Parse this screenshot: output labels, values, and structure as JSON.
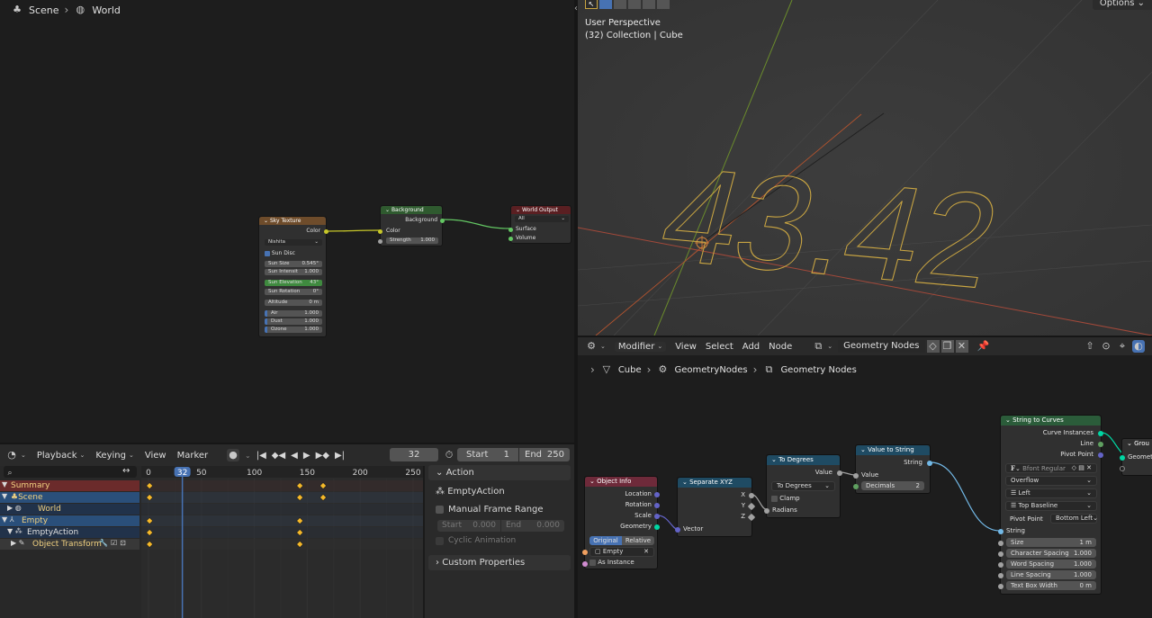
{
  "shader_editor": {
    "breadcrumb": [
      "Scene",
      "World"
    ],
    "sky_texture": {
      "title": "Sky Texture",
      "output": "Color",
      "type": "Nishita",
      "sun_disc": "Sun Disc",
      "sun_size": {
        "label": "Sun Size",
        "value": "0.545°"
      },
      "sun_intensity": {
        "label": "Sun Intensit",
        "value": "1.000"
      },
      "sun_elevation": {
        "label": "Sun Elevation",
        "value": "43°"
      },
      "sun_rotation": {
        "label": "Sun Rotation",
        "value": "0°"
      },
      "altitude": {
        "label": "Altitude",
        "value": "0 m"
      },
      "air": {
        "label": "Air",
        "value": "1.000"
      },
      "dust": {
        "label": "Dust",
        "value": "1.000"
      },
      "ozone": {
        "label": "Ozone",
        "value": "1.000"
      }
    },
    "background": {
      "title": "Background",
      "output": "Background",
      "color": "Color",
      "strength": {
        "label": "Strength",
        "value": "1.000"
      }
    },
    "world_output": {
      "title": "World Output",
      "target": "All",
      "surface": "Surface",
      "volume": "Volume"
    }
  },
  "viewport": {
    "options": "Options",
    "perspective": "User Perspective",
    "collection": "(32) Collection | Cube",
    "text_object": "43.42"
  },
  "geo_editor": {
    "menu": {
      "modifier": "Modifier",
      "view": "View",
      "select": "Select",
      "add": "Add",
      "node": "Node",
      "tree_name": "Geometry Nodes"
    },
    "breadcrumb": [
      "Cube",
      "GeometryNodes",
      "Geometry Nodes"
    ],
    "object_info": {
      "title": "Object Info",
      "outputs": [
        "Location",
        "Rotation",
        "Scale",
        "Geometry"
      ],
      "mode_original": "Original",
      "mode_relative": "Relative",
      "object": "Empty",
      "as_instance": "As Instance"
    },
    "separate_xyz": {
      "title": "Separate XYZ",
      "x": "X",
      "y": "Y",
      "z": "Z",
      "vector": "Vector"
    },
    "to_degrees": {
      "title": "To Degrees",
      "value": "Value",
      "op": "To Degrees",
      "clamp": "Clamp",
      "radians": "Radians"
    },
    "value_to_string": {
      "title": "Value to String",
      "string": "String",
      "value": "Value",
      "decimals": {
        "label": "Decimals",
        "value": "2"
      }
    },
    "string_to_curves": {
      "title": "String to Curves",
      "curve_instances": "Curve Instances",
      "line": "Line",
      "pivot_point_out": "Pivot Point",
      "font": "Bfont Regular",
      "overflow": "Overflow",
      "align_x": "Left",
      "align_y": "Top Baseline",
      "pivot_point": {
        "label": "Pivot Point",
        "value": "Bottom Left"
      },
      "string": "String",
      "size": {
        "label": "Size",
        "value": "1 m"
      },
      "char_spacing": {
        "label": "Character Spacing",
        "value": "1.000"
      },
      "word_spacing": {
        "label": "Word Spacing",
        "value": "1.000"
      },
      "line_spacing": {
        "label": "Line Spacing",
        "value": "1.000"
      },
      "text_box_width": {
        "label": "Text Box Width",
        "value": "0 m"
      }
    },
    "group_output": {
      "title": "Grou",
      "geometry": "Geomet"
    }
  },
  "timeline": {
    "menu": {
      "playback": "Playback",
      "keying": "Keying",
      "view": "View",
      "marker": "Marker"
    },
    "current_frame": "32",
    "start_label": "Start",
    "start": "1",
    "end_label": "End",
    "end": "250",
    "ruler": [
      "0",
      "32",
      "50",
      "100",
      "150",
      "200",
      "250"
    ],
    "channels": [
      {
        "label": "Summary",
        "kind": "summary"
      },
      {
        "label": "Scene",
        "kind": "scene"
      },
      {
        "label": "World",
        "kind": "world"
      },
      {
        "label": "Empty",
        "kind": "object"
      },
      {
        "label": "EmptyAction",
        "kind": "action"
      },
      {
        "label": "Object Transform",
        "kind": "group"
      }
    ],
    "keyframes": [
      {
        "channel": 0,
        "frames": [
          1,
          143,
          165
        ]
      },
      {
        "channel": 1,
        "frames": [
          1,
          143,
          165
        ]
      },
      {
        "channel": 3,
        "frames": [
          1,
          143
        ]
      },
      {
        "channel": 4,
        "frames": [
          1,
          143
        ]
      },
      {
        "channel": 5,
        "frames": [
          1,
          143
        ]
      }
    ]
  },
  "action_panel": {
    "title": "Action",
    "action_name": "EmptyAction",
    "manual_frame_range": "Manual Frame Range",
    "start": {
      "label": "Start",
      "value": "0.000"
    },
    "end": {
      "label": "End",
      "value": "0.000"
    },
    "cyclic": "Cyclic Animation",
    "custom_props": "Custom Properties"
  },
  "colors": {
    "sky_header": "#6e4c2b",
    "background_header": "#2f5a2f",
    "output_header": "#5a1f22",
    "geo_header": "#1f4b63",
    "string_curves_header": "#2b5c3a",
    "keyframe": "#f5b829",
    "summary_row": "#6b2b2b",
    "scene_row": "#2a4f7a",
    "playhead": "#4772b3"
  }
}
